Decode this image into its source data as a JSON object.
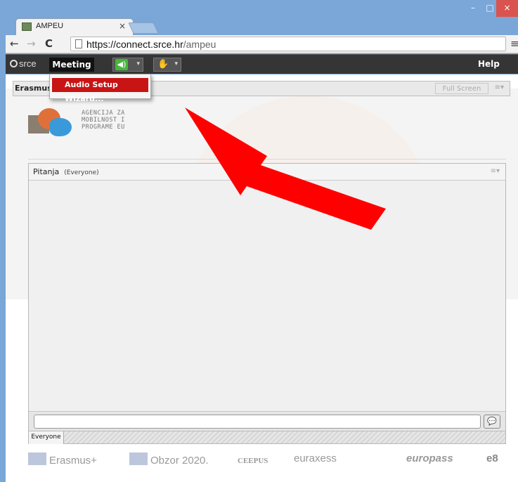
{
  "browser": {
    "tab_title": "AMPEU",
    "tab_close": "×",
    "window_min": "–",
    "window_max": "□",
    "window_close": "×",
    "url_host": "https://connect.srce.hr",
    "url_path": "/ampeu",
    "nav_back": "←",
    "nav_forward": "→",
    "nav_reload": "C",
    "menu_glyph": "≡"
  },
  "appbar": {
    "brand": "srce",
    "meeting_label": "Meeting",
    "help_label": "Help",
    "speaker_glyph": "◀)",
    "raise_glyph": "✋",
    "dropdown_glyph": "▾"
  },
  "dropdown": {
    "items": [
      "Audio Setup Wizard..."
    ]
  },
  "pod": {
    "title": "Erasmus",
    "fullscreen_label": "Full Screen",
    "menu_glyph": "≡▾"
  },
  "agency": {
    "lines": [
      "AGENCIJA ZA",
      "MOBILNOST I",
      "PROGRAME EU"
    ]
  },
  "chat": {
    "title": "Pitanja",
    "audience": "(Everyone)",
    "input_value": "",
    "send_glyph": "💬",
    "tab_label": "Everyone",
    "menu_glyph": "≡▾"
  },
  "footer": {
    "logos": [
      "Erasmus+",
      "Obzor 2020.",
      "CEEPUS",
      "euraxess",
      "europass",
      "e8"
    ]
  },
  "colors": {
    "accent_red": "#c81414",
    "speaker_green": "#46b83a",
    "appbar": "#353535",
    "chrome_blue": "#7aa6d8"
  }
}
